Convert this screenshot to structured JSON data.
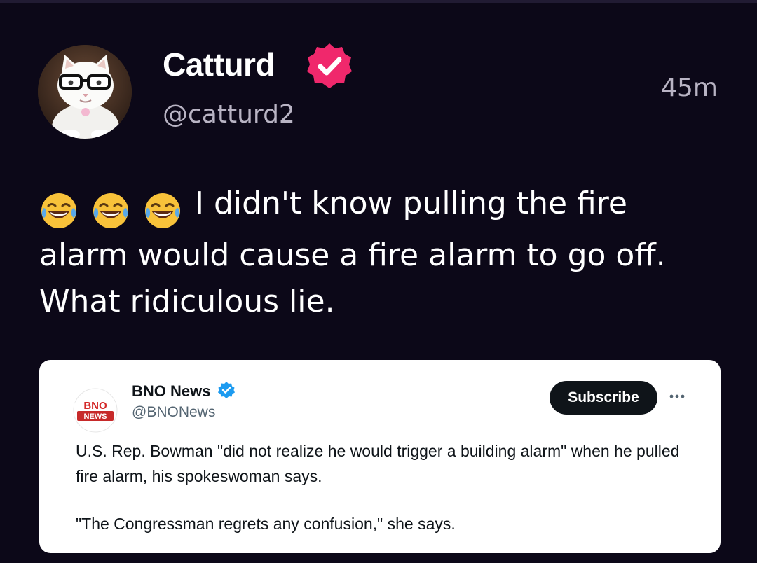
{
  "tweet": {
    "display_name": "Catturd",
    "handle": "@catturd2",
    "timestamp": "45m",
    "verified_badge_color": "#f0286c",
    "avatar_icon": "cat-with-glasses-avatar",
    "emojis": [
      "😂",
      "😂",
      "😂"
    ],
    "text": "I didn't know pulling the fire alarm would cause a fire alarm to go off. What ridiculous lie."
  },
  "quoted_post": {
    "logo_text_top": "BNO",
    "logo_text_bottom": "NEWS",
    "name": "BNO News",
    "handle": "@BNONews",
    "verified_badge_color": "#1d9bf0",
    "subscribe_label": "Subscribe",
    "more_icon": "more-dots-icon",
    "paragraphs": [
      "U.S. Rep. Bowman \"did not realize he would trigger a building alarm\" when he pulled fire alarm, his spokeswoman says.",
      "\"The Congressman regrets any confusion,\" she says."
    ]
  },
  "colors": {
    "background": "#0c0818",
    "card_background": "#ffffff",
    "secondary_text": "#b9b4c4"
  }
}
